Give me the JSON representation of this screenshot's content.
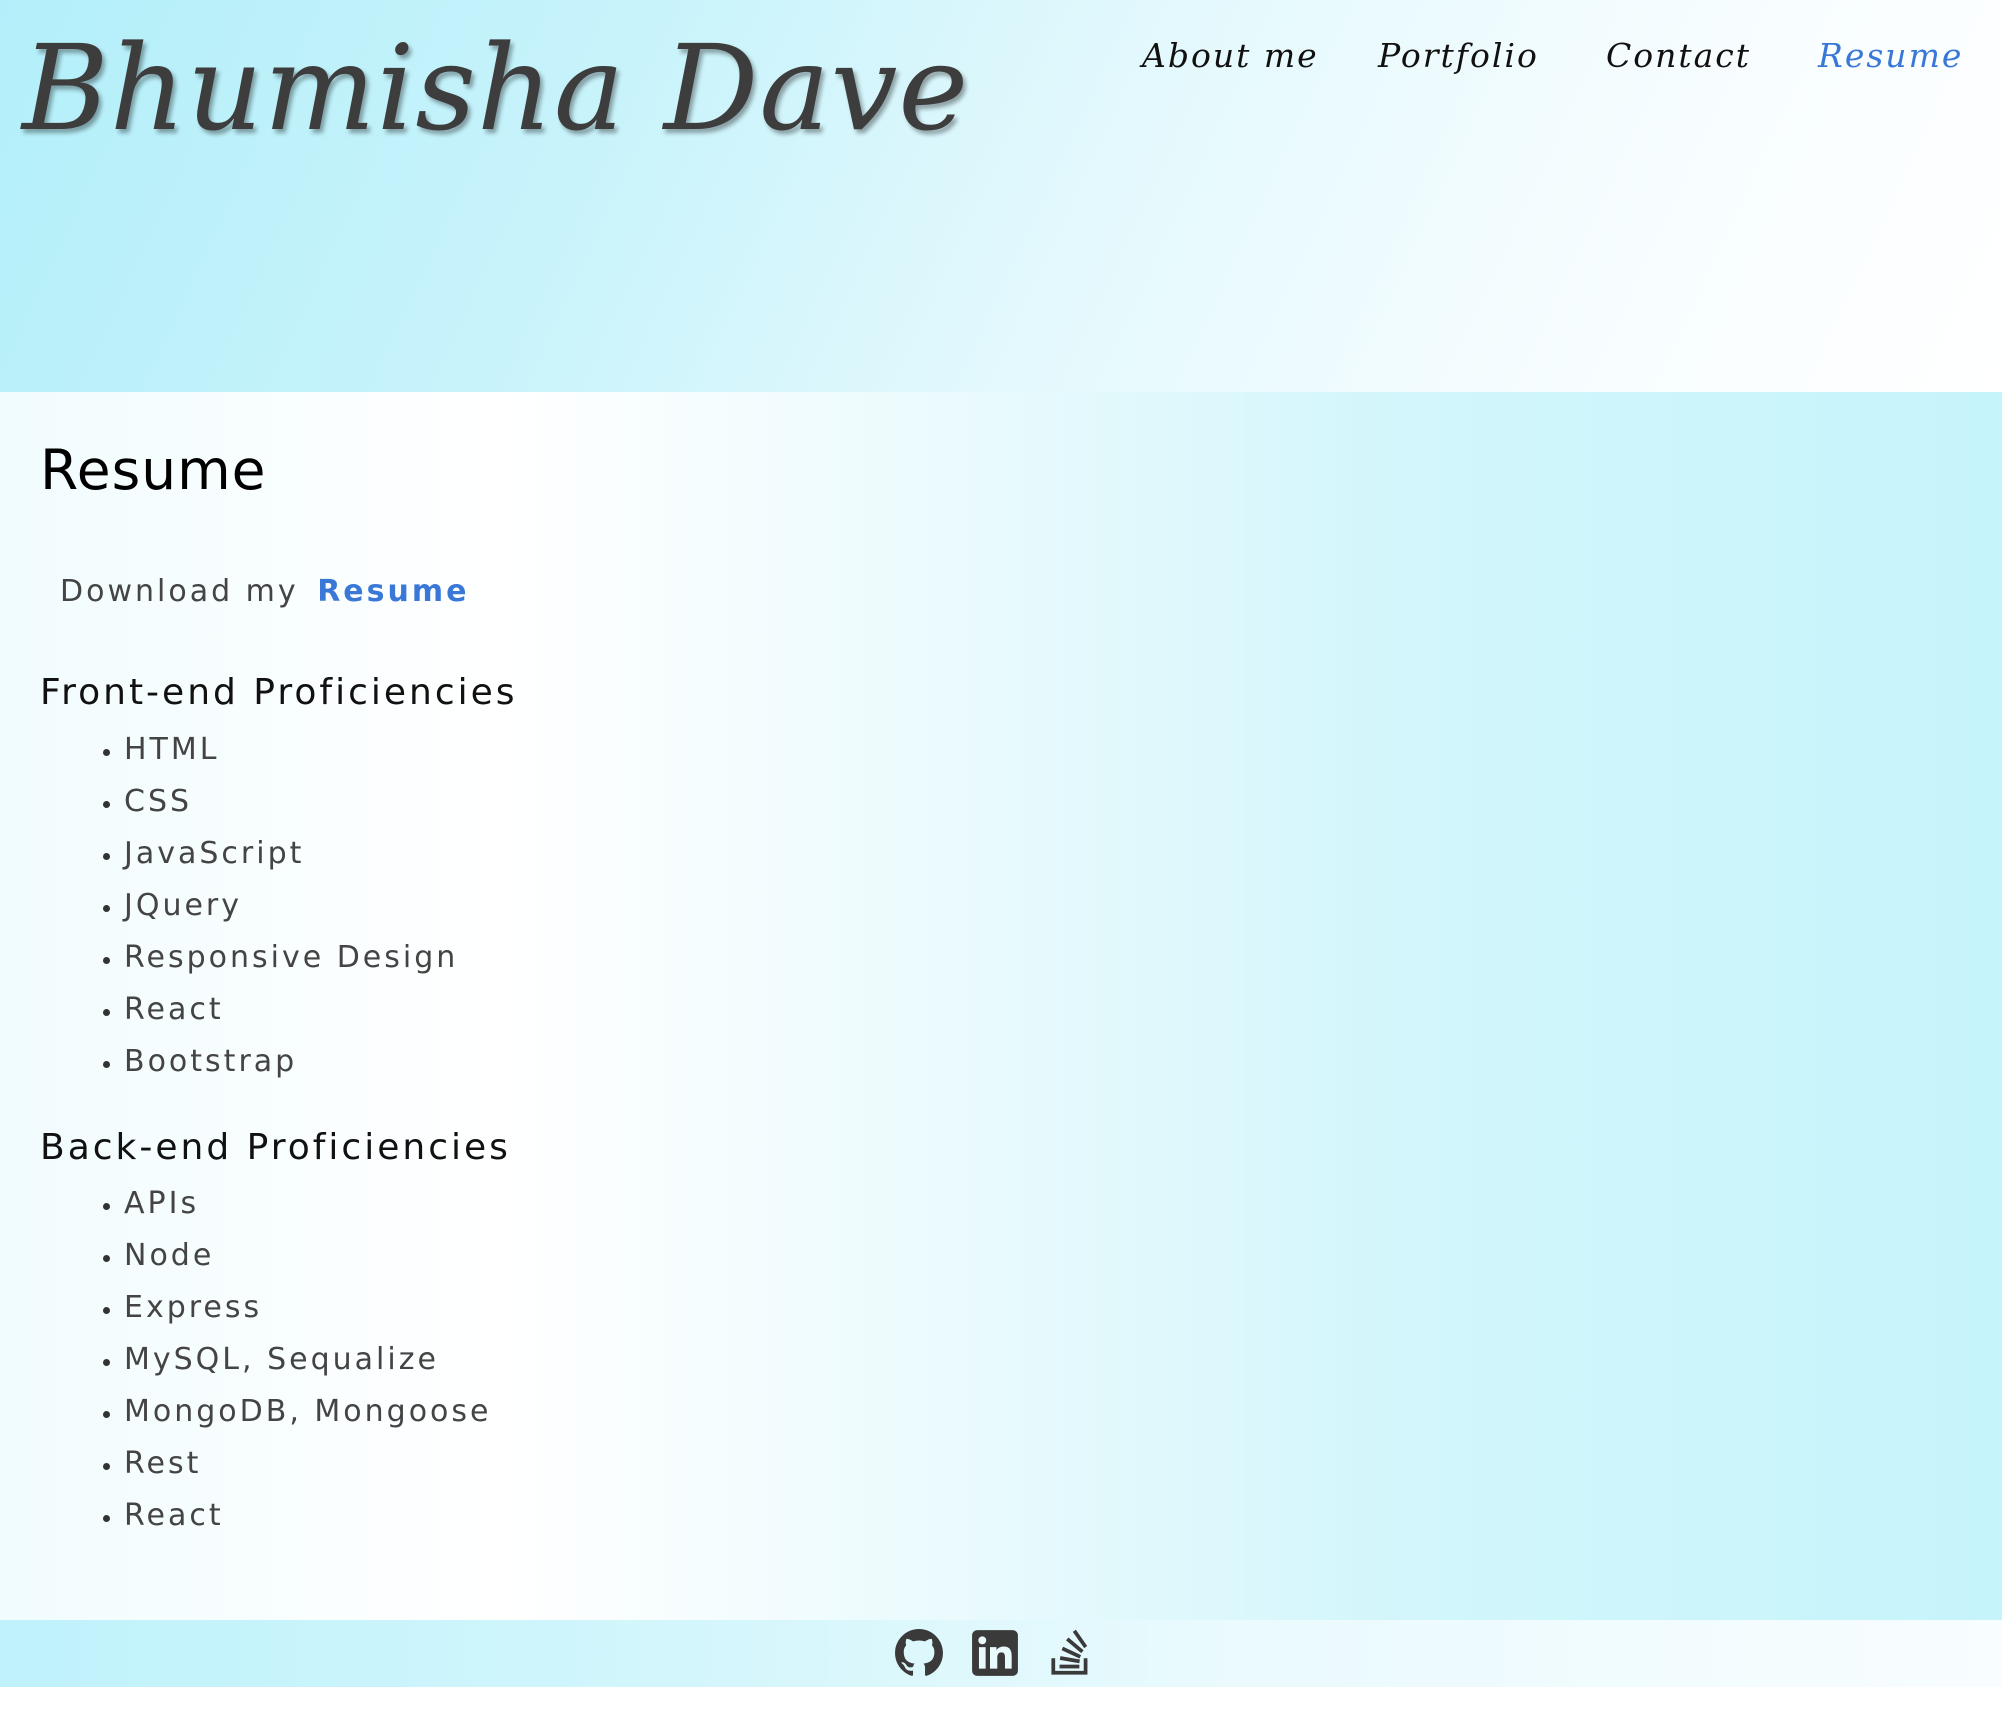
{
  "header": {
    "site_title": "Bhumisha Dave",
    "nav": [
      {
        "label": "About me",
        "active": false
      },
      {
        "label": "Portfolio",
        "active": false
      },
      {
        "label": "Contact",
        "active": false
      },
      {
        "label": "Resume",
        "active": true
      }
    ]
  },
  "main": {
    "title": "Resume",
    "download_text": "Download my",
    "download_link": "Resume",
    "front_end": {
      "title": "Front-end Proficiencies",
      "items": [
        "HTML",
        "CSS",
        "JavaScript",
        "JQuery",
        "Responsive Design",
        "React",
        "Bootstrap"
      ]
    },
    "back_end": {
      "title": "Back-end Proficiencies",
      "items": [
        "APIs",
        "Node",
        "Express",
        "MySQL, Sequalize",
        "MongoDB, Mongoose",
        "Rest",
        "React"
      ]
    }
  },
  "footer": {
    "social_icons": [
      "github-icon",
      "linkedin-icon",
      "stackoverflow-icon"
    ]
  },
  "colors": {
    "accent": "#3a78d8",
    "header_gradient_start": "#b3effa",
    "text_dark": "#444444",
    "icon": "#3a3a3a"
  }
}
